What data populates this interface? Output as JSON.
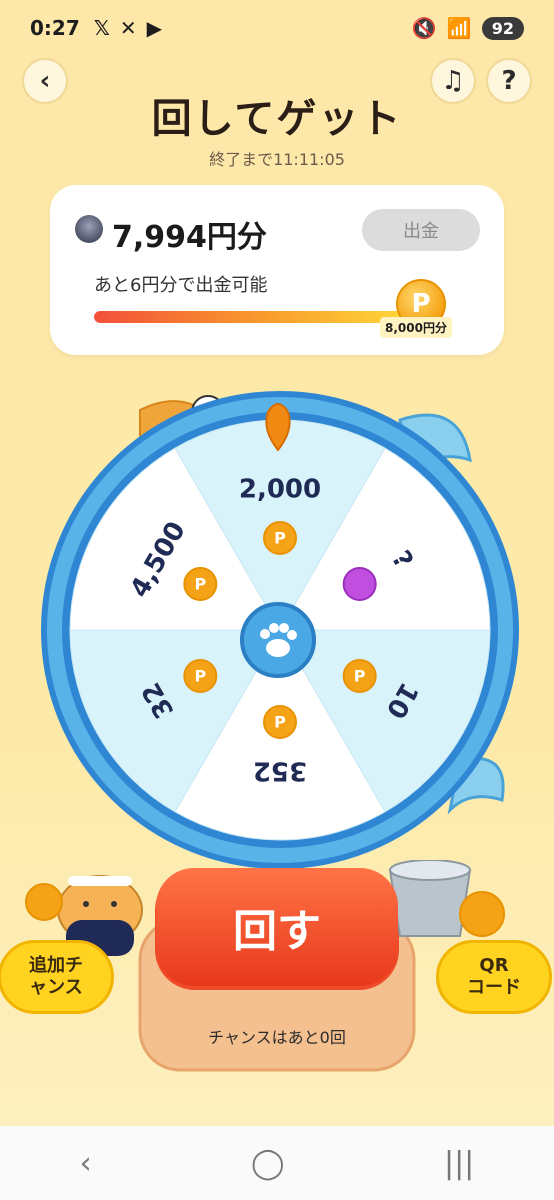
{
  "status_bar": {
    "time": "0:27",
    "battery": "92"
  },
  "header": {
    "back_icon": "chevron-left-icon",
    "music_icon": "music-note-icon",
    "help_label": "?",
    "title": "回してゲット",
    "countdown": "終了まで11:11:05"
  },
  "balance_card": {
    "amount": "7,994円分",
    "withdraw_label": "出金",
    "remaining_text": "あと6円分で出金可能",
    "goal_label": "8,000円分",
    "coin_label": "P",
    "progress": 0.99
  },
  "wheel": {
    "segments": [
      {
        "label": "2,000"
      },
      {
        "label": "?"
      },
      {
        "label": "10"
      },
      {
        "label": "352"
      },
      {
        "label": "32"
      },
      {
        "label": "4,500"
      }
    ],
    "center_icon": "paw-icon",
    "coin_label": "P",
    "colors": {
      "light": "#d9f3fb",
      "white": "#ffffff",
      "rim": "#2f87d4"
    }
  },
  "spin_button": {
    "label": "回す"
  },
  "side_buttons": {
    "left_label_1": "追加チ",
    "left_label_2": "ャンス",
    "right_label_1": "QR",
    "right_label_2": "コード"
  },
  "chance_text": "チャンスはあと0回"
}
